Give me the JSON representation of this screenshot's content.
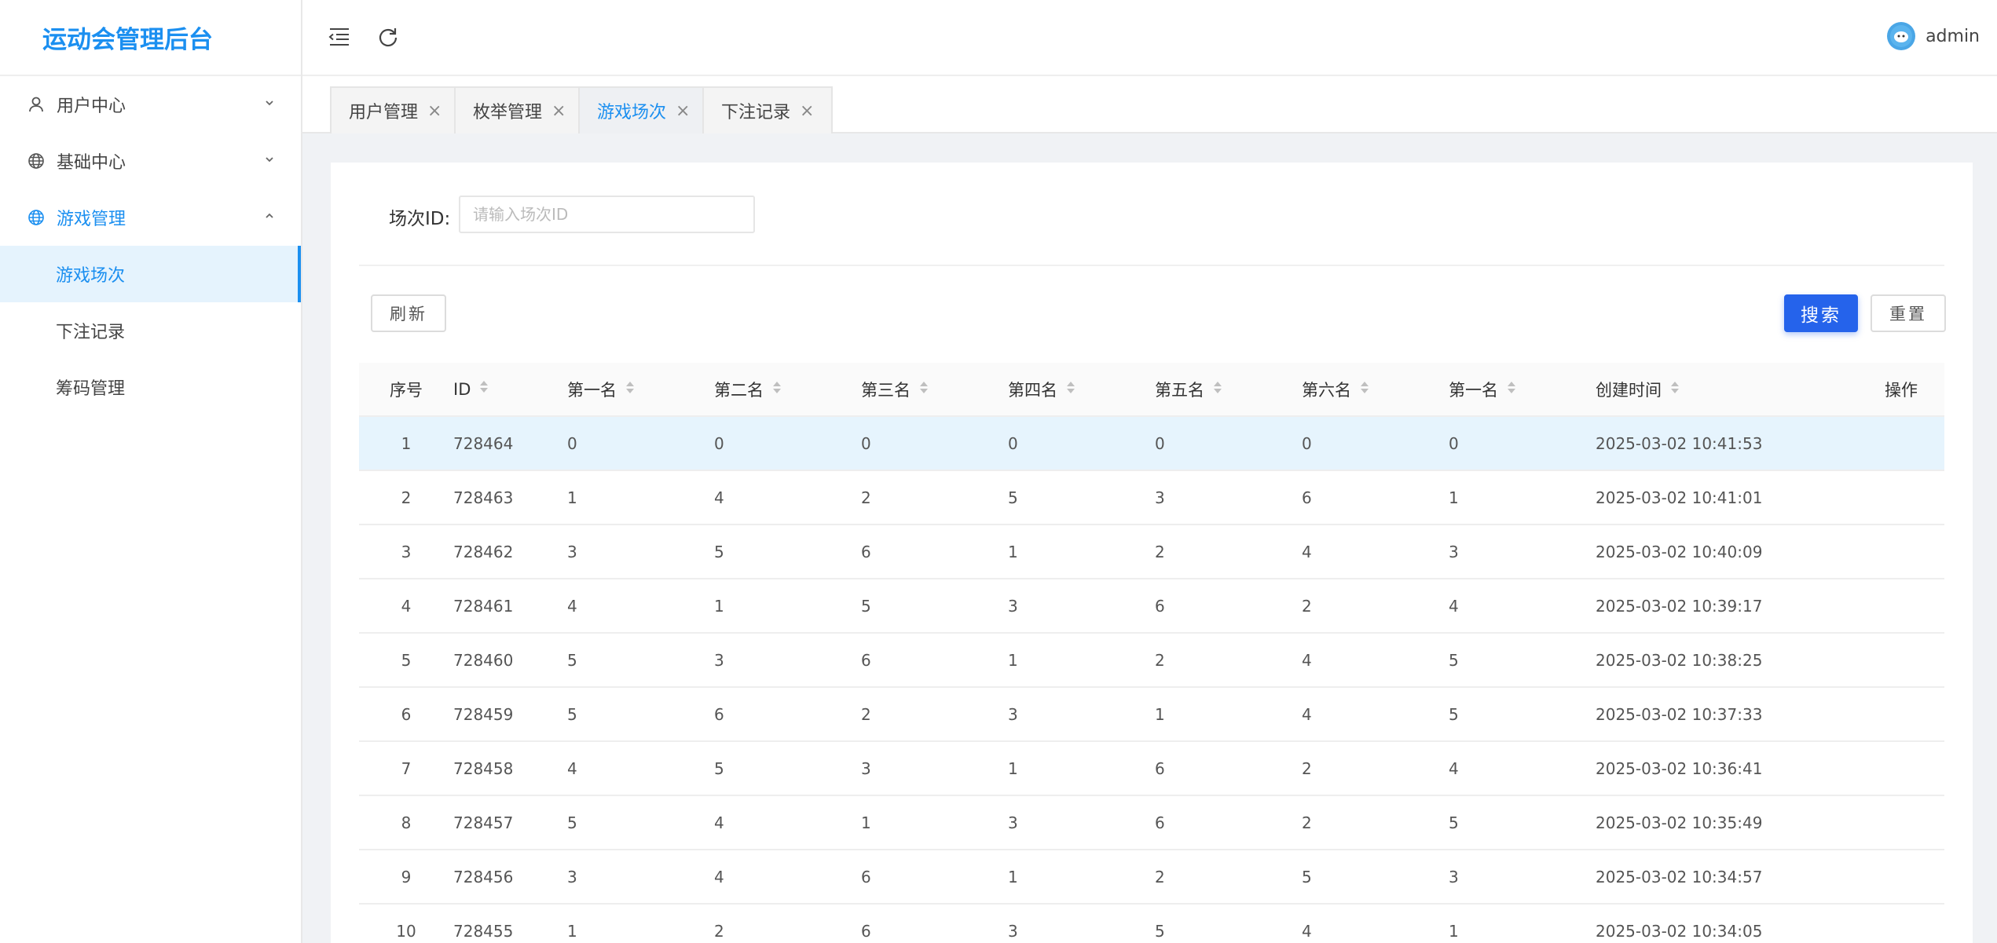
{
  "app": {
    "title": "运动会管理后台"
  },
  "sidebar": {
    "menus": [
      {
        "label": "用户中心",
        "icon": "user-icon",
        "expanded": false
      },
      {
        "label": "基础中心",
        "icon": "globe-icon",
        "expanded": false
      },
      {
        "label": "游戏管理",
        "icon": "globe-icon",
        "expanded": true,
        "children": [
          {
            "label": "游戏场次",
            "active": true
          },
          {
            "label": "下注记录",
            "active": false
          },
          {
            "label": "筹码管理",
            "active": false
          }
        ]
      }
    ]
  },
  "header": {
    "username": "admin"
  },
  "tabs": [
    {
      "label": "用户管理",
      "active": false
    },
    {
      "label": "枚举管理",
      "active": false
    },
    {
      "label": "游戏场次",
      "active": true
    },
    {
      "label": "下注记录",
      "active": false
    }
  ],
  "filter": {
    "label": "场次ID:",
    "placeholder": "请输入场次ID",
    "value": ""
  },
  "buttons": {
    "refresh": "刷新",
    "search": "搜索",
    "reset": "重置"
  },
  "table": {
    "columns": [
      "序号",
      "ID",
      "第一名",
      "第二名",
      "第三名",
      "第四名",
      "第五名",
      "第六名",
      "第一名",
      "创建时间",
      "操作"
    ],
    "rows": [
      [
        "1",
        "728464",
        "0",
        "0",
        "0",
        "0",
        "0",
        "0",
        "0",
        "2025-03-02 10:41:53",
        ""
      ],
      [
        "2",
        "728463",
        "1",
        "4",
        "2",
        "5",
        "3",
        "6",
        "1",
        "2025-03-02 10:41:01",
        ""
      ],
      [
        "3",
        "728462",
        "3",
        "5",
        "6",
        "1",
        "2",
        "4",
        "3",
        "2025-03-02 10:40:09",
        ""
      ],
      [
        "4",
        "728461",
        "4",
        "1",
        "5",
        "3",
        "6",
        "2",
        "4",
        "2025-03-02 10:39:17",
        ""
      ],
      [
        "5",
        "728460",
        "5",
        "3",
        "6",
        "1",
        "2",
        "4",
        "5",
        "2025-03-02 10:38:25",
        ""
      ],
      [
        "6",
        "728459",
        "5",
        "6",
        "2",
        "3",
        "1",
        "4",
        "5",
        "2025-03-02 10:37:33",
        ""
      ],
      [
        "7",
        "728458",
        "4",
        "5",
        "3",
        "1",
        "6",
        "2",
        "4",
        "2025-03-02 10:36:41",
        ""
      ],
      [
        "8",
        "728457",
        "5",
        "4",
        "1",
        "3",
        "6",
        "2",
        "5",
        "2025-03-02 10:35:49",
        ""
      ],
      [
        "9",
        "728456",
        "3",
        "4",
        "6",
        "1",
        "2",
        "5",
        "3",
        "2025-03-02 10:34:57",
        ""
      ],
      [
        "10",
        "728455",
        "1",
        "2",
        "6",
        "3",
        "5",
        "4",
        "1",
        "2025-03-02 10:34:05",
        ""
      ]
    ]
  },
  "colors": {
    "primary": "#1b8ff0",
    "button": "#2563eb",
    "highlight_row": "#e6f4fd"
  }
}
